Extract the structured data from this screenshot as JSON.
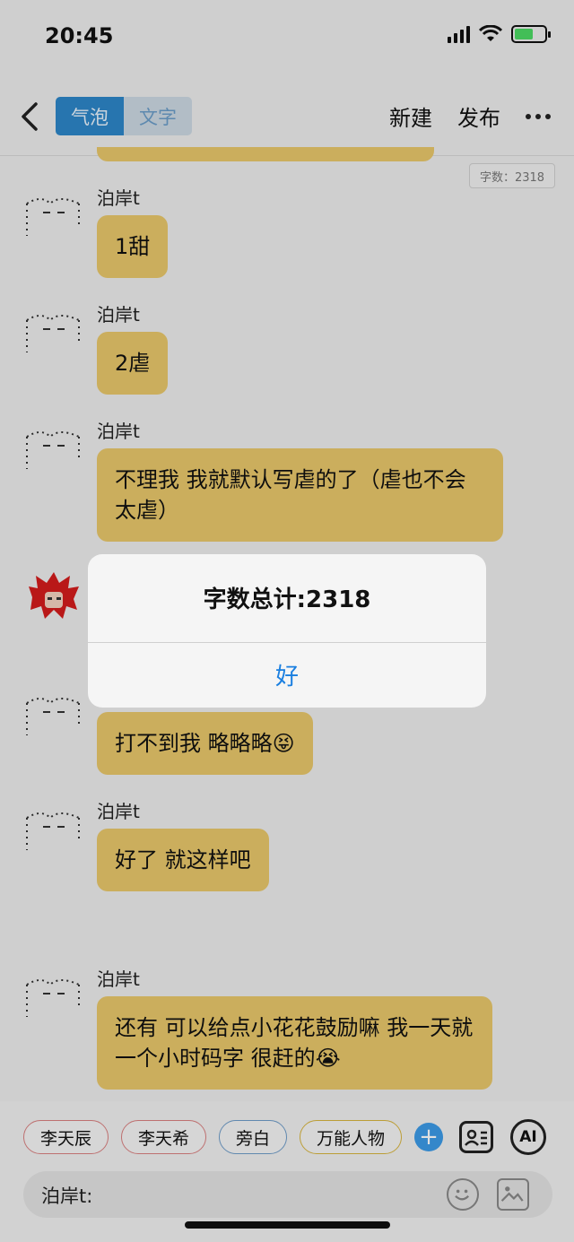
{
  "status": {
    "time": "20:45"
  },
  "header": {
    "tab_bubble": "气泡",
    "tab_text": "文字",
    "new_label": "新建",
    "publish_label": "发布"
  },
  "word_count_badge": "字数：2318",
  "messages": [
    {
      "name": "泊岸t",
      "text": "1甜"
    },
    {
      "name": "泊岸t",
      "text": "2虐"
    },
    {
      "name": "泊岸t",
      "text": "不理我 我就默认写虐的了（虐也不会太虐）"
    },
    {
      "name": "",
      "text": "打不到我 略略略😝"
    },
    {
      "name": "泊岸t",
      "text": "好了 就这样吧"
    },
    {
      "name": "泊岸t",
      "text": "还有 可以给点小花花鼓励嘛 我一天就一个小时码字 很赶的😭"
    }
  ],
  "dialog": {
    "title": "字数总计:2318",
    "ok": "好"
  },
  "bottom": {
    "chips": [
      "李天辰",
      "李天希",
      "旁白",
      "万能人物"
    ],
    "ai_label": "AI",
    "input_prefix": "泊岸t:"
  },
  "colors": {
    "bubble": "#e8c76a",
    "accent": "#2d86c8",
    "dialog_button": "#1a7fe0"
  }
}
